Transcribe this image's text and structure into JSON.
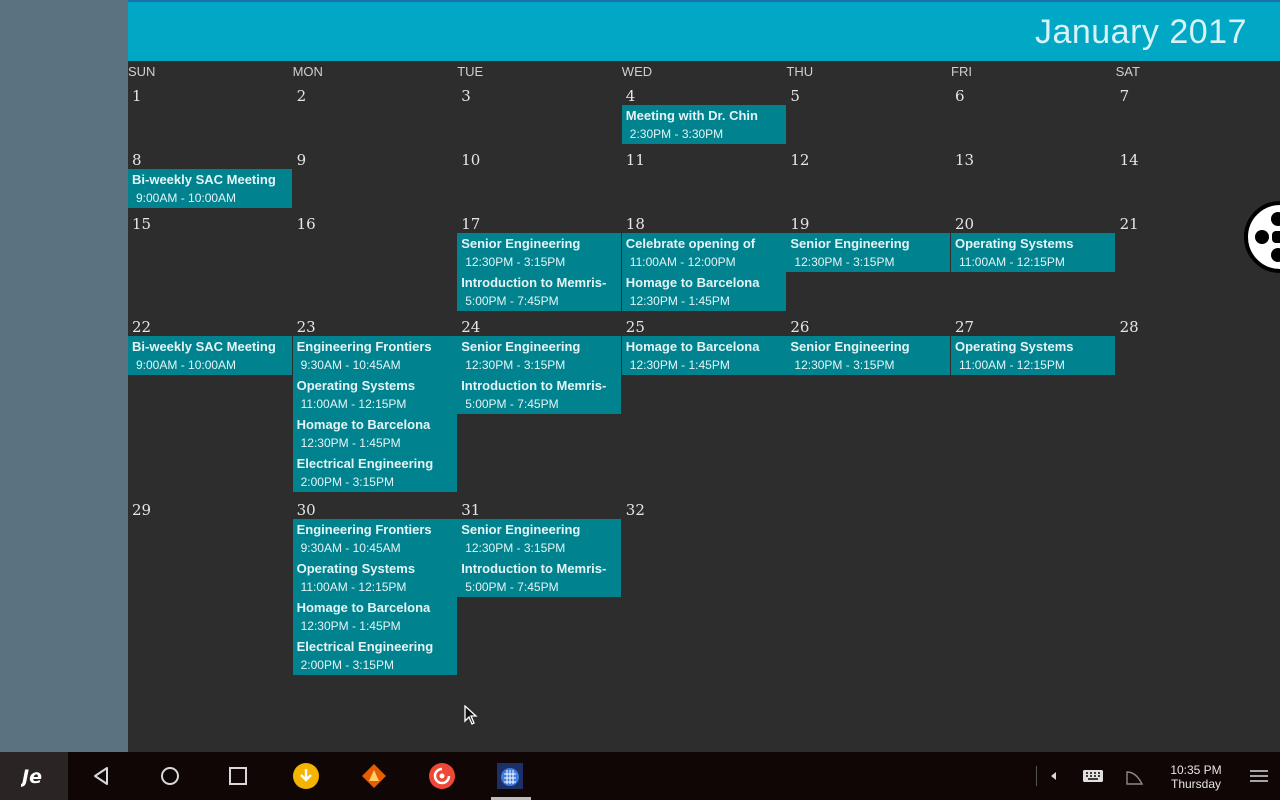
{
  "header": {
    "title": "January 2017"
  },
  "weekdays": [
    "SUN",
    "MON",
    "TUE",
    "WED",
    "THU",
    "FRI",
    "SAT"
  ],
  "days": [
    "1",
    "2",
    "3",
    "4",
    "5",
    "6",
    "7",
    "8",
    "9",
    "10",
    "11",
    "12",
    "13",
    "14",
    "15",
    "16",
    "17",
    "18",
    "19",
    "20",
    "21",
    "22",
    "23",
    "24",
    "25",
    "26",
    "27",
    "28",
    "29",
    "30",
    "31",
    "32"
  ],
  "events": [
    {
      "day": "4",
      "title": "Meeting with Dr. Chin",
      "time": "2:30PM - 3:30PM"
    },
    {
      "day": "8",
      "title": "Bi-weekly SAC Meeting",
      "time": "9:00AM - 10:00AM"
    },
    {
      "day": "17",
      "title": "Senior Engineering",
      "time": "12:30PM - 3:15PM"
    },
    {
      "day": "17",
      "title": "Introduction to Memris-",
      "time": "5:00PM - 7:45PM"
    },
    {
      "day": "18",
      "title": "Celebrate opening of",
      "time": "11:00AM - 12:00PM"
    },
    {
      "day": "18",
      "title": "Homage to Barcelona",
      "time": "12:30PM - 1:45PM"
    },
    {
      "day": "19",
      "title": "Senior Engineering",
      "time": "12:30PM - 3:15PM"
    },
    {
      "day": "20",
      "title": "Operating Systems",
      "time": "11:00AM - 12:15PM"
    },
    {
      "day": "22",
      "title": "Bi-weekly SAC Meeting",
      "time": "9:00AM - 10:00AM"
    },
    {
      "day": "23",
      "title": "Engineering Frontiers",
      "time": "9:30AM - 10:45AM"
    },
    {
      "day": "23",
      "title": "Operating Systems",
      "time": "11:00AM - 12:15PM"
    },
    {
      "day": "23",
      "title": "Homage to Barcelona",
      "time": "12:30PM - 1:45PM"
    },
    {
      "day": "23",
      "title": "Electrical Engineering",
      "time": "2:00PM - 3:15PM"
    },
    {
      "day": "24",
      "title": "Senior Engineering",
      "time": "12:30PM - 3:15PM"
    },
    {
      "day": "24",
      "title": "Introduction to Memris-",
      "time": "5:00PM - 7:45PM"
    },
    {
      "day": "25",
      "title": "Homage to Barcelona",
      "time": "12:30PM - 1:45PM"
    },
    {
      "day": "26",
      "title": "Senior Engineering",
      "time": "12:30PM - 3:15PM"
    },
    {
      "day": "27",
      "title": "Operating Systems",
      "time": "11:00AM - 12:15PM"
    },
    {
      "day": "30",
      "title": "Engineering Frontiers",
      "time": "9:30AM - 10:45AM"
    },
    {
      "day": "30",
      "title": "Operating Systems",
      "time": "11:00AM - 12:15PM"
    },
    {
      "day": "30",
      "title": "Homage to Barcelona",
      "time": "12:30PM - 1:45PM"
    },
    {
      "day": "30",
      "title": "Electrical Engineering",
      "time": "2:00PM - 3:15PM"
    },
    {
      "day": "31",
      "title": "Senior Engineering",
      "time": "12:30PM - 3:15PM"
    },
    {
      "day": "31",
      "title": "Introduction to Memris-",
      "time": "5:00PM - 7:45PM"
    }
  ],
  "taskbar": {
    "clock_time": "10:35 PM",
    "clock_day": "Thursday",
    "icons": [
      "jide-logo-icon",
      "back-icon",
      "home-icon",
      "recents-icon",
      "download-app-icon",
      "vlc-app-icon",
      "pocket-casts-app-icon",
      "calendar-app-icon",
      "tray-expand-icon",
      "keyboard-icon",
      "signal-icon",
      "notifications-menu-icon"
    ]
  },
  "colors": {
    "header": "#00a8c6",
    "event": "#00838f",
    "background": "#2d2d2d",
    "side_panel": "#5b7381",
    "taskbar": "#110606"
  }
}
